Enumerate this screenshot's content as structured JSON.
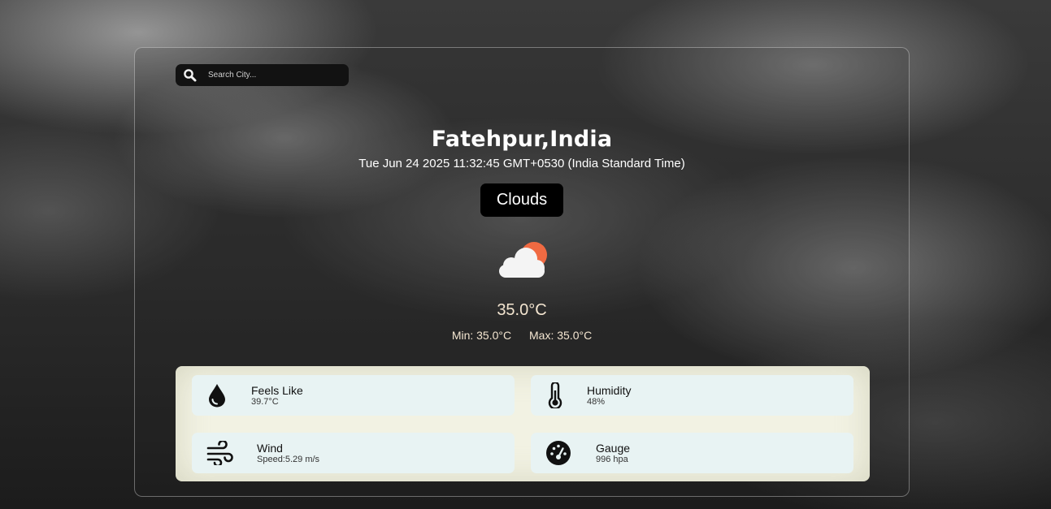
{
  "search": {
    "placeholder": "Search City..."
  },
  "location": {
    "city": "Fatehpur,India",
    "datetime": "Tue Jun 24 2025 11:32:45 GMT+0530 (India Standard Time)"
  },
  "weather": {
    "condition": "Clouds",
    "icon": "cloud-sun-icon",
    "temperature": "35.0°C",
    "min": "Min: 35.0°C",
    "max": "Max: 35.0°C"
  },
  "details": [
    {
      "title": "Feels Like",
      "value": "39.7°C",
      "icon": "water-drop-icon"
    },
    {
      "title": "Humidity",
      "value": "48%",
      "icon": "thermometer-icon"
    },
    {
      "title": "Wind",
      "value": "Speed:5.29 m/s",
      "icon": "wind-icon"
    },
    {
      "title": "Gauge",
      "value": "996 hpa",
      "icon": "gauge-icon"
    }
  ],
  "colors": {
    "panel": "#f2f2e3",
    "tile": "#e8f3f3",
    "badge": "#000000",
    "sun": "#f06a42",
    "accent_text": "#f3e5d0"
  }
}
